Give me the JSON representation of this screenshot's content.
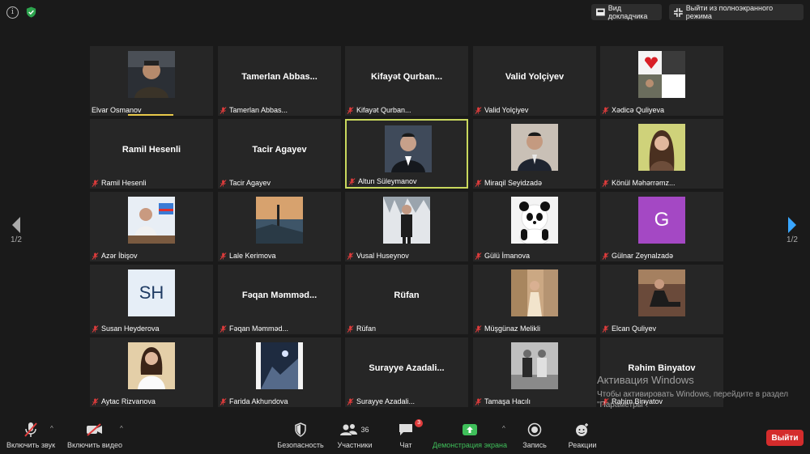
{
  "topbar": {
    "speaker_view": "Вид докладчика",
    "exit_fullscreen": "Выйти из полноэкранного режима"
  },
  "pagination": {
    "left": "1/2",
    "right": "1/2"
  },
  "participants": [
    {
      "name": "Elvar Osmanov",
      "video": true,
      "photo": "person-in-car"
    },
    {
      "name": "Tamerlan  Abbas...",
      "video": false
    },
    {
      "name": "Kifayət  Qurban...",
      "video": false
    },
    {
      "name": "Valid Yolçiyev",
      "video": false
    },
    {
      "name": "Xədicə Quliyeva",
      "video": false,
      "photo": "collage"
    },
    {
      "name": "Ramil Hesenli",
      "video": false
    },
    {
      "name": "Tacir Agayev",
      "video": false
    },
    {
      "name": "Altun Süleymanov",
      "video": false,
      "photo": "man-in-suit",
      "active": true
    },
    {
      "name": "Miraqil Seyidzadə",
      "video": false,
      "photo": "man-in-suit-2"
    },
    {
      "name": "Könül Məhərrəmz...",
      "video": false,
      "photo": "woman-portrait"
    },
    {
      "name": "Azər İbişov",
      "video": false,
      "photo": "man-at-desk"
    },
    {
      "name": "Lale Kerimova",
      "video": false,
      "photo": "sunset-scene"
    },
    {
      "name": "Vusal Huseynov",
      "video": false,
      "photo": "man-in-snow"
    },
    {
      "name": "Gülü İmanova",
      "video": false,
      "photo": "panda"
    },
    {
      "name": "Gülnar Zeynalzadə",
      "video": false,
      "avatar_letter": "G",
      "avatar_color": "#a448c4"
    },
    {
      "name": "Susan Heyderova",
      "video": false,
      "avatar_letter": "SH",
      "avatar_color": "#e6eef7"
    },
    {
      "name": "Fəqan  Məmməd...",
      "video": false
    },
    {
      "name": "Rüfan",
      "video": false
    },
    {
      "name": "Müşgünaz Melikli",
      "video": false,
      "photo": "woman-old-town"
    },
    {
      "name": "Elcan Quliyev",
      "video": false,
      "photo": "man-sitting"
    },
    {
      "name": "Aytac Rizvanova",
      "video": false,
      "photo": "woman-white"
    },
    {
      "name": "Farida Akhundova",
      "video": false,
      "photo": "night-scene"
    },
    {
      "name": "Surayye  Azadali...",
      "video": false
    },
    {
      "name": "Tamaşa Hacılı",
      "video": false,
      "photo": "couple-bw"
    },
    {
      "name": "Rəhim Binyatov",
      "video": false
    }
  ],
  "watermark": {
    "line1": "Активация Windows",
    "line2": "Чтобы активировать Windows, перейдите в раздел \"Параметры\"."
  },
  "toolbar": {
    "mute": "Включить звук",
    "video": "Включить видео",
    "security": "Безопасность",
    "participants": "Участники",
    "participants_count": "36",
    "chat": "Чат",
    "chat_badge": "3",
    "share": "Демонстрация экрана",
    "record": "Запись",
    "reactions": "Реакции",
    "leave": "Выйти"
  },
  "colors": {
    "active_border": "#c9d85d",
    "share_green": "#3fbf5a",
    "leave_red": "#d42c2c",
    "muted_red": "#e03c3c"
  }
}
